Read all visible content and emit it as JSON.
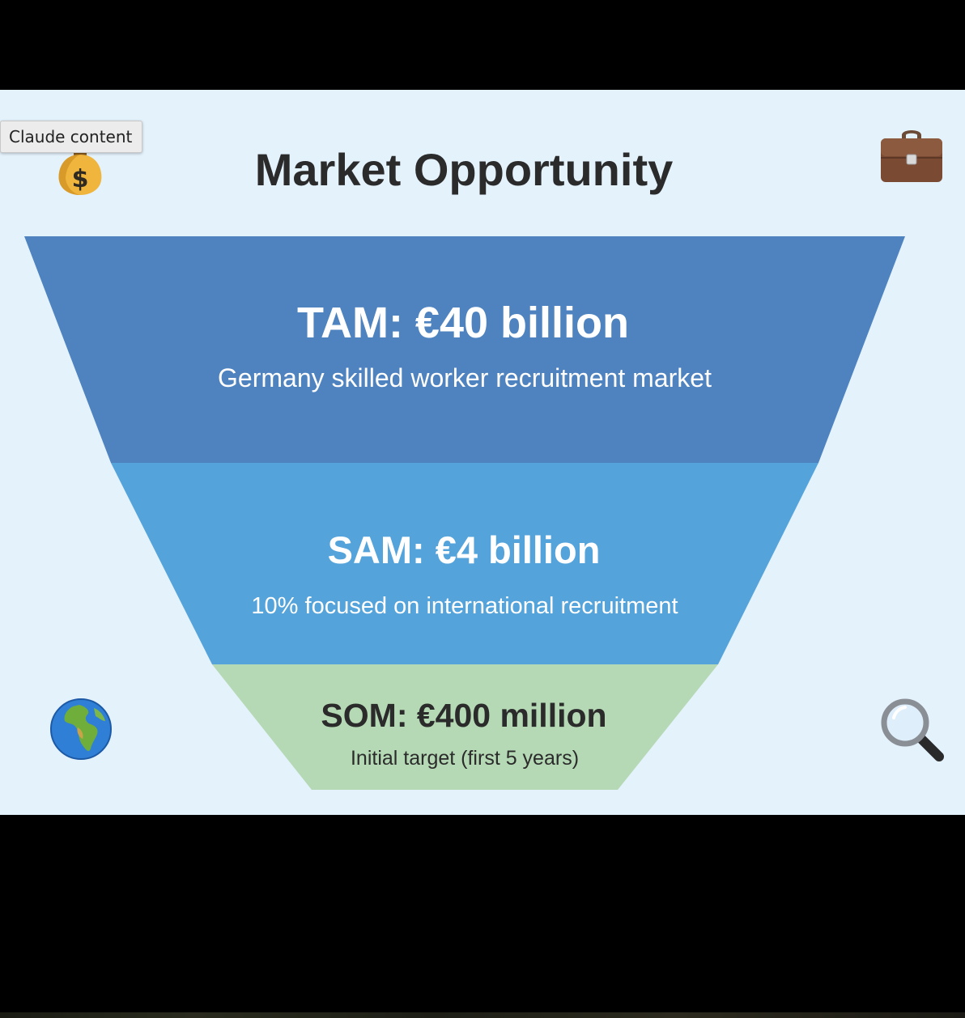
{
  "tooltip": {
    "text": "Claude content"
  },
  "slide": {
    "title": "Market Opportunity",
    "icons": {
      "top_left": "money-bag-icon",
      "top_right": "briefcase-icon",
      "bottom_left": "globe-icon",
      "bottom_right": "magnifying-glass-icon"
    },
    "funnel": [
      {
        "heading": "TAM: €40 billion",
        "subtext": "Germany skilled worker recruitment market",
        "color": "#4f83bf",
        "text_color": "#ffffff"
      },
      {
        "heading": "SAM: €4 billion",
        "subtext": "10% focused on international recruitment",
        "color": "#54a3da",
        "text_color": "#ffffff"
      },
      {
        "heading": "SOM: €400 million",
        "subtext": "Initial target (first 5 years)",
        "color": "#b5d9b5",
        "text_color": "#2b2b2b"
      }
    ]
  },
  "colors": {
    "page_background": "#000000",
    "slide_background": "#e4f2fc",
    "title": "#2b2b2b"
  }
}
